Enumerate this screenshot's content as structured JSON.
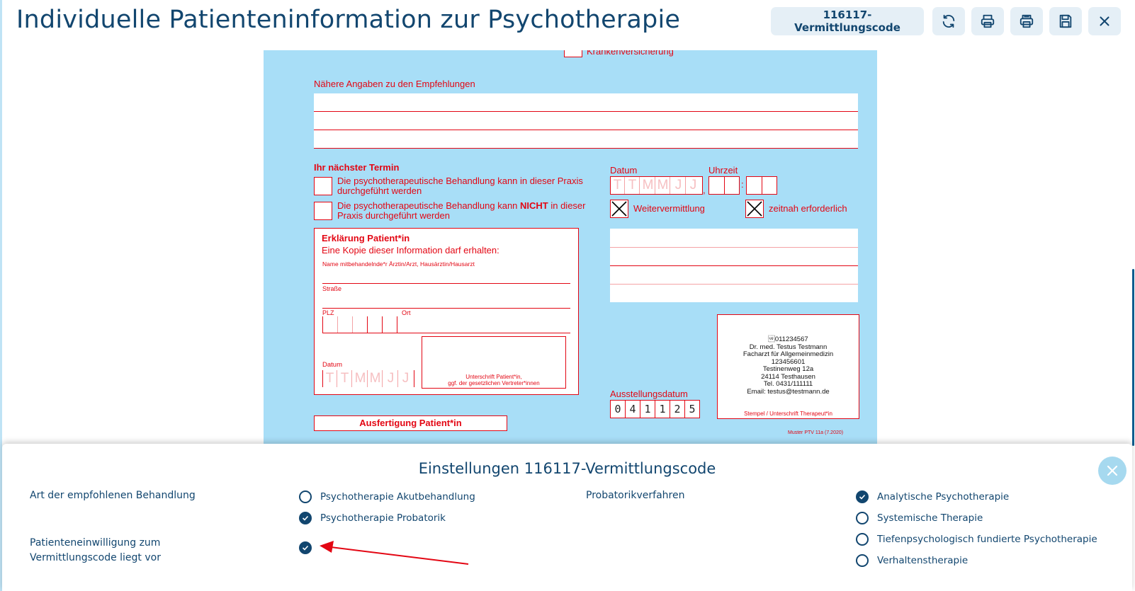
{
  "header": {
    "title": "Individuelle Patienteninformation zur Psychotherapie",
    "vermittlungscode_button": "116117-Vermittlungscode",
    "icons": [
      "refresh-icon",
      "print-icon",
      "print-multiple-icon",
      "save-icon",
      "close-icon"
    ]
  },
  "form": {
    "top_option": "Krankenversicherung",
    "naehere_angaben_label": "Nähere Angaben zu den Empfehlungen",
    "naechster_termin_label": "Ihr nächster Termin",
    "option_kann": "Die psychotherapeutische Behandlung kann in dieser Praxis durchgeführt werden",
    "option_kann_nicht_pre": "Die psychotherapeutische Behandlung kann ",
    "option_kann_nicht_bold": "NICHT",
    "option_kann_nicht_post": " in dieser Praxis durchgeführt werden",
    "datum_label": "Datum",
    "uhrzeit_label": "Uhrzeit",
    "date_placeholder": [
      "T",
      "T",
      "M",
      "M",
      "J",
      "J"
    ],
    "time_separator_comma": ",",
    "time_separator_colon": ":",
    "weitervermittlung_label": "Weitervermittlung",
    "weitervermittlung_checked": true,
    "zeitnah_label": "zeitnah erforderlich",
    "zeitnah_checked": true,
    "erklaerung_title": "Erklärung Patient*in",
    "erklaerung_subtitle": "Eine Kopie dieser Information darf erhalten:",
    "name_field_label": "Name mitbehandelnde*r Ärztin/Arzt, Hausärztin/Hausarzt",
    "strasse_label": "Straße",
    "plz_label": "PLZ",
    "ort_label": "Ort",
    "erklaerung_datum_label": "Datum",
    "unterschrift_line1": "Unterschrift Patient*in,",
    "unterschrift_line2": "ggf. der gesetzlichen Vertreter*innen",
    "ausstellungsdatum_label": "Ausstellungsdatum",
    "ausstellungsdatum_digits": [
      "0",
      "4",
      "1",
      "1",
      "2",
      "5"
    ],
    "stamp": {
      "lines": [
        "\u001f011234567",
        "Dr. med. Testus Testmann",
        "Facharzt für Allgemeinmedizin",
        "123456601",
        "Testinenweg 12a",
        "24114 Testhausen",
        "Tel. 0431/111111",
        "Email: testus@testmann.de"
      ],
      "caption": "Stempel / Unterschrift Therapeut*in"
    },
    "ausfertigung_label": "Ausfertigung Patient*in",
    "muster_label": "Muster PTV 11a (7.2020)"
  },
  "settings": {
    "title": "Einstellungen 116117-Vermittlungscode",
    "art_label": "Art der empfohlenen Behandlung",
    "art_options": [
      {
        "label": "Psychotherapie Akutbehandlung",
        "selected": false
      },
      {
        "label": "Psychotherapie Probatorik",
        "selected": true
      }
    ],
    "einwilligung_label_line1": "Patienteneinwilligung zum",
    "einwilligung_label_line2": "Vermittlungscode liegt vor",
    "einwilligung_checked": true,
    "probatorik_label": "Probatorikverfahren",
    "probatorik_options": [
      {
        "label": "Analytische Psychotherapie",
        "selected": true
      },
      {
        "label": "Systemische Therapie",
        "selected": false
      },
      {
        "label": "Tiefenpsychologisch fundierte Psychotherapie",
        "selected": false
      },
      {
        "label": "Verhaltenstherapie",
        "selected": false
      }
    ]
  },
  "colors": {
    "brand": "#12466f",
    "form_background": "#a8def7",
    "form_red": "#e30613",
    "button_background": "#e5eff6",
    "annotation_arrow": "#e30613"
  }
}
